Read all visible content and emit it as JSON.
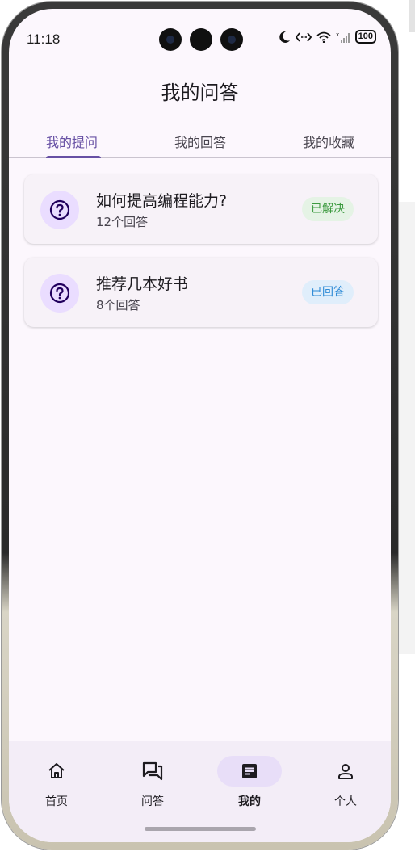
{
  "status_bar": {
    "time": "11:18",
    "battery": "100"
  },
  "header": {
    "title": "我的问答"
  },
  "tabs": [
    {
      "label": "我的提问",
      "active": true
    },
    {
      "label": "我的回答",
      "active": false
    },
    {
      "label": "我的收藏",
      "active": false
    }
  ],
  "questions": [
    {
      "title": "如何提高编程能力?",
      "answers": "12个回答",
      "status": "已解决",
      "icon": "question-circle-icon"
    },
    {
      "title": "推荐几本好书",
      "answers": "8个回答",
      "status": "已回答",
      "icon": "question-circle-icon"
    }
  ],
  "bottom_nav": [
    {
      "label": "首页",
      "icon": "home-icon",
      "active": false
    },
    {
      "label": "问答",
      "icon": "chat-icon",
      "active": false
    },
    {
      "label": "我的",
      "icon": "article-icon",
      "active": true
    },
    {
      "label": "个人",
      "icon": "person-icon",
      "active": false
    }
  ],
  "colors": {
    "primary": "#6750a4",
    "resolved": "#3c9a3f",
    "answered": "#2d8ad6",
    "background": "#fcf7fd"
  }
}
